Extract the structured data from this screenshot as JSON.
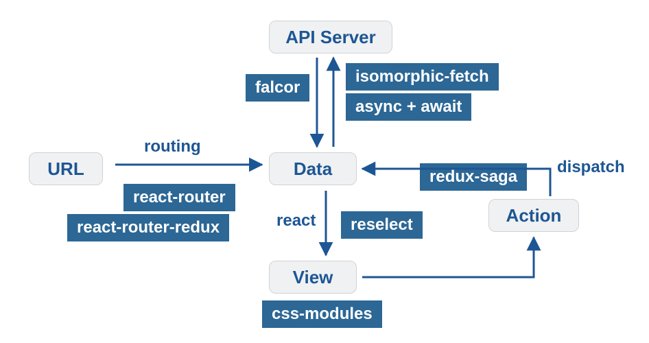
{
  "nodes": {
    "api_server": "API Server",
    "url": "URL",
    "data": "Data",
    "view": "View",
    "action": "Action"
  },
  "tags": {
    "falcor": "falcor",
    "isomorphic_fetch": "isomorphic-fetch",
    "async_await": "async + await",
    "react_router": "react-router",
    "react_router_redux": "react-router-redux",
    "redux_saga": "redux-saga",
    "reselect": "reselect",
    "css_modules": "css-modules"
  },
  "edges": {
    "routing": "routing",
    "react": "react",
    "dispatch": "dispatch"
  },
  "colors": {
    "node_text": "#1d5694",
    "node_bg": "#f0f1f2",
    "node_border": "#cfd3d6",
    "tag_bg": "#2c6795",
    "tag_text": "#ffffff",
    "arrow": "#1d5694"
  }
}
